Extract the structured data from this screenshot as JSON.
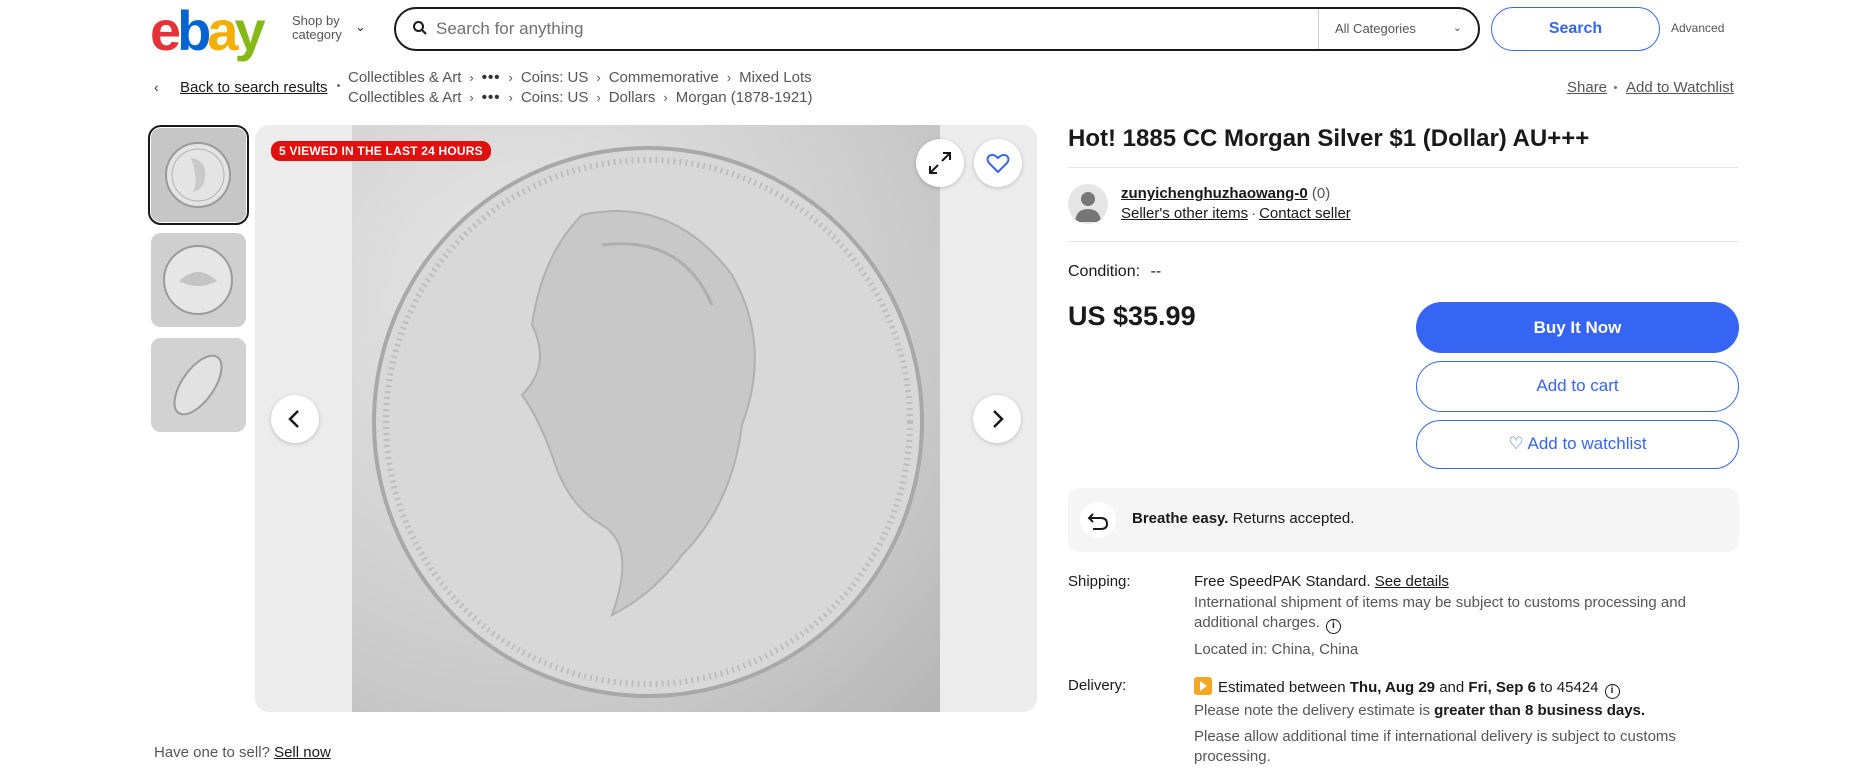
{
  "header": {
    "logo_letters": [
      "e",
      "b",
      "a",
      "y"
    ],
    "shop_by_line1": "Shop by",
    "shop_by_line2": "category",
    "search_placeholder": "Search for anything",
    "category_select": "All Categories",
    "search_button": "Search",
    "advanced_link": "Advanced"
  },
  "breadcrumb": {
    "back_link": "Back to search results",
    "row1": [
      "Collectibles & Art",
      "Coins: US",
      "Commemorative",
      "Mixed Lots"
    ],
    "row2": [
      "Collectibles & Art",
      "Coins: US",
      "Dollars",
      "Morgan (1878-1921)"
    ],
    "more": "•••"
  },
  "actions": {
    "share": "Share",
    "add_to_watchlist": "Add to Watchlist"
  },
  "gallery": {
    "viewed_badge": "5 VIEWED IN THE LAST 24 HOURS",
    "thumbnails": [
      "coin-obverse",
      "coin-reverse",
      "coin-edge"
    ],
    "selected_index": 0
  },
  "listing": {
    "title": "Hot!  1885 CC Morgan Silver $1 (Dollar) AU+++",
    "seller_name": "zunyichenghuzhaowang-0",
    "seller_feedback": "(0)",
    "seller_other_items": "Seller's other items",
    "contact_seller": "Contact seller",
    "condition_label": "Condition:",
    "condition_value": "--",
    "price": "US $35.99",
    "buy_it_now": "Buy It Now",
    "add_to_cart": "Add to cart",
    "add_to_watchlist": "Add to watchlist"
  },
  "returns": {
    "bold": "Breathe easy.",
    "text": "Returns accepted."
  },
  "shipping": {
    "label": "Shipping:",
    "free": "Free",
    "method": "SpeedPAK Standard.",
    "see_details": "See details",
    "intl_line1": "International shipment of items may be subject to customs processing and",
    "intl_line2": "additional charges.",
    "located": "Located in: China, China"
  },
  "delivery": {
    "label": "Delivery:",
    "estimated": "Estimated between",
    "date1": "Thu, Aug 29",
    "and": "and",
    "date2": "Fri, Sep 6",
    "to_zip": "to 45424",
    "note_prefix": "Please note the delivery estimate is",
    "note_bold": "greater than 8 business days.",
    "allow_line1": "Please allow additional time if international delivery is subject to customs",
    "allow_line2": "processing."
  },
  "sell": {
    "prompt": "Have one to sell?",
    "link": "Sell now"
  },
  "colors": {
    "primary": "#3665f3",
    "badge": "#e0100e",
    "text": "#191919",
    "muted": "#555555"
  }
}
